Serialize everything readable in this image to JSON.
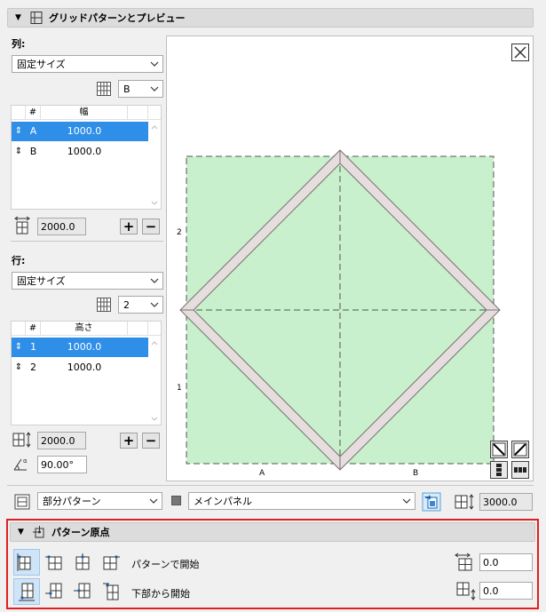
{
  "grid_section": {
    "title": "グリッドパターンとプレビュー",
    "columns": {
      "label": "列:",
      "mode": "固定サイズ",
      "count_value": "B",
      "headers": [
        "#",
        "幅"
      ],
      "rows": [
        {
          "id": "A",
          "width": "1000.0",
          "selected": true
        },
        {
          "id": "B",
          "width": "1000.0",
          "selected": false
        }
      ],
      "total": "2000.0",
      "add_label": "+",
      "remove_label": "−"
    },
    "rows": {
      "label": "行:",
      "mode": "固定サイズ",
      "count_value": "2",
      "headers": [
        "#",
        "高さ"
      ],
      "rows": [
        {
          "id": "1",
          "height": "1000.0",
          "selected": true
        },
        {
          "id": "2",
          "height": "1000.0",
          "selected": false
        }
      ],
      "total": "2000.0",
      "angle": "90.00°",
      "add_label": "+",
      "remove_label": "−"
    },
    "preview": {
      "row_labels": [
        "2",
        "1"
      ],
      "col_labels": [
        "A",
        "B"
      ],
      "colors": {
        "fill": "#c8f0cc",
        "frame": "#e6dede",
        "frame_stroke": "#7a7070"
      }
    },
    "bottom": {
      "pattern_mode": "部分パターン",
      "panel": "メインパネル",
      "height_value": "3000.0"
    }
  },
  "origin_section": {
    "title": "パターン原点",
    "row1_label": "パターンで開始",
    "row2_label": "下部から開始",
    "offset_x": "0.0",
    "offset_y": "0.0"
  },
  "highlight_color": "#e02020"
}
